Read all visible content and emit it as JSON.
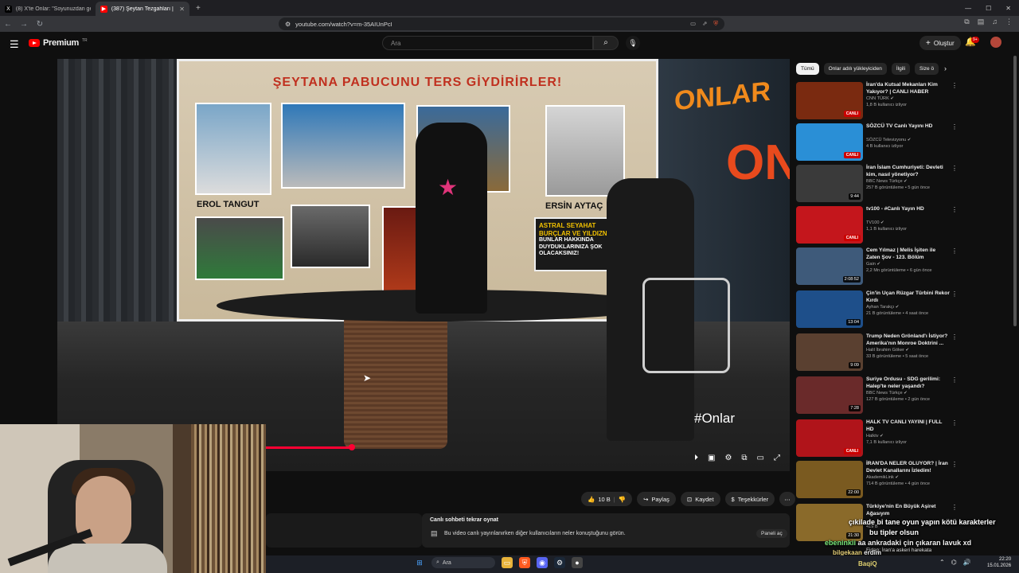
{
  "browser": {
    "tabs": [
      {
        "icon": "X",
        "label": "(8) X'te Onlar: \"Soyunuzdan gelen g…",
        "active": false
      },
      {
        "icon": "▶",
        "label": "(387) Şeytan Tezgahları | Doğ…",
        "active": true
      }
    ],
    "new_tab": "+",
    "url": "youtube.com/watch?v=m-35AIUnPcI"
  },
  "youtube": {
    "brand": "Premium",
    "region": "TR",
    "search_placeholder": "Ara",
    "create_label": "Oluştur",
    "notif_count": "9+"
  },
  "video": {
    "board_title": "ŞEYTANA PABUCUNU TERS GİYDİRİRLER!",
    "caption_left": "EROL TANGUT",
    "caption_right": "ERSİN AYTAÇ",
    "poster_line1": "ASTRAL SEYAHAT",
    "poster_line2": "BURÇLAR VE YILDIZNAME",
    "poster_line3": "BUNLAR HAKKINDA DUYDUKLARINIZA ŞOK OLACAKSINIZ!",
    "sign_small": "ONLAR",
    "sign_big": "ON",
    "watermark": "#Onlar",
    "progress_fraction": 0.12
  },
  "actions": {
    "likes": "10 B",
    "share": "Paylaş",
    "save": "Kaydet",
    "thanks": "Teşekkürler"
  },
  "chat": {
    "title": "Canlı sohbeti tekrar oynat",
    "description": "Bu video canlı yayınlanırken diğer kullanıcıların neler konuştuğunu görün.",
    "panel_button": "Paneli aç"
  },
  "chips": [
    "Tümü",
    "Onlar adılı yükleyiciden",
    "İlgili",
    "Size ö"
  ],
  "recommendations": [
    {
      "title": "İran'da Kutsal Mekanları Kim Yakıyor? | CANLI HABER",
      "channel": "CNN TÜRK ✔",
      "meta": "1,8 B kullanıcı izliyor",
      "badge": "CANLI",
      "bg": "#7a2a10"
    },
    {
      "title": "SÖZCÜ TV Canlı Yayını HD",
      "channel": "SÖZCÜ Televizyonu ✔",
      "meta": "4 B kullanıcı izliyor",
      "badge": "CANLI",
      "bg": "#2a8fd6"
    },
    {
      "title": "İran İslam Cumhuriyeti: Devleti kim, nasıl yönetiyor?",
      "channel": "BBC News Türkçe ✔",
      "meta": "257 B görüntüleme • 5 gün önce",
      "badge": "9:44",
      "bg": "#3a3a3a"
    },
    {
      "title": "tv100 - #Canlı Yayın HD",
      "channel": "TV100 ✔",
      "meta": "1,1 B kullanıcı izliyor",
      "badge": "CANLI",
      "bg": "#c4161c"
    },
    {
      "title": "Cem Yılmaz | Melis İşiten ile Zaten Şov - 123. Bölüm",
      "channel": "Gain ✔",
      "meta": "2,2 Mn görüntüleme • 6 gün önce",
      "badge": "2:08:52",
      "bg": "#3e5a7a"
    },
    {
      "title": "Çin'in Uçan Rüzgar Türbini Rekor Kırdı",
      "channel": "Ayhan Tarakçı ✔",
      "meta": "21 B görüntüleme • 4 saat önce",
      "badge": "13:04",
      "bg": "#1e4f8a"
    },
    {
      "title": "Trump Neden Grönland'ı İstiyor? Amerika'nın Monroe Doktrini ...",
      "channel": "Halil İbrahim Göker ✔",
      "meta": "33 B görüntüleme • 5 saat önce",
      "badge": "9:09",
      "bg": "#5a4030"
    },
    {
      "title": "Suriye Ordusu - SDG gerilimi: Halep'te neler yaşandı?",
      "channel": "BBC News Türkçe ✔",
      "meta": "127 B görüntüleme • 2 gün önce",
      "badge": "7:28",
      "bg": "#6a2a2a"
    },
    {
      "title": "HALK TV CANLI YAYINI | FULL HD",
      "channel": "Halktv ✔",
      "meta": "7,1 B kullanıcı izliyor",
      "badge": "CANLI",
      "bg": "#b0141a"
    },
    {
      "title": "İRAN'DA NELER OLUYOR? | İran Devlet Kanallarını İzledim!",
      "channel": "AkademikLink ✔",
      "meta": "714 B görüntüleme • 4 gün önce",
      "badge": "22:00",
      "bg": "#7a5a20"
    },
    {
      "title": "Türkiye'nin En Büyük Aşiret Ağasıyım",
      "channel": "",
      "meta": "419 B",
      "badge": "21:30",
      "bg": "#8a6a2a"
    }
  ],
  "recommendation_extra": "Fidan: İran'a askeri harekata",
  "overlay_chat": {
    "line1": "çıkilade  bi tane oyun yapın kötü karakterler",
    "line2": "bu tipler olsun",
    "user3": "ebeninkii",
    "line3": "aa ankradaki çin çıkaran lavuk xd",
    "user4": "bilgekaan",
    "line4": "erdim"
  },
  "taskbar": {
    "search": "Ara",
    "streamer": "BaqiQ",
    "time": "22:20",
    "date": "15.01.2026"
  }
}
